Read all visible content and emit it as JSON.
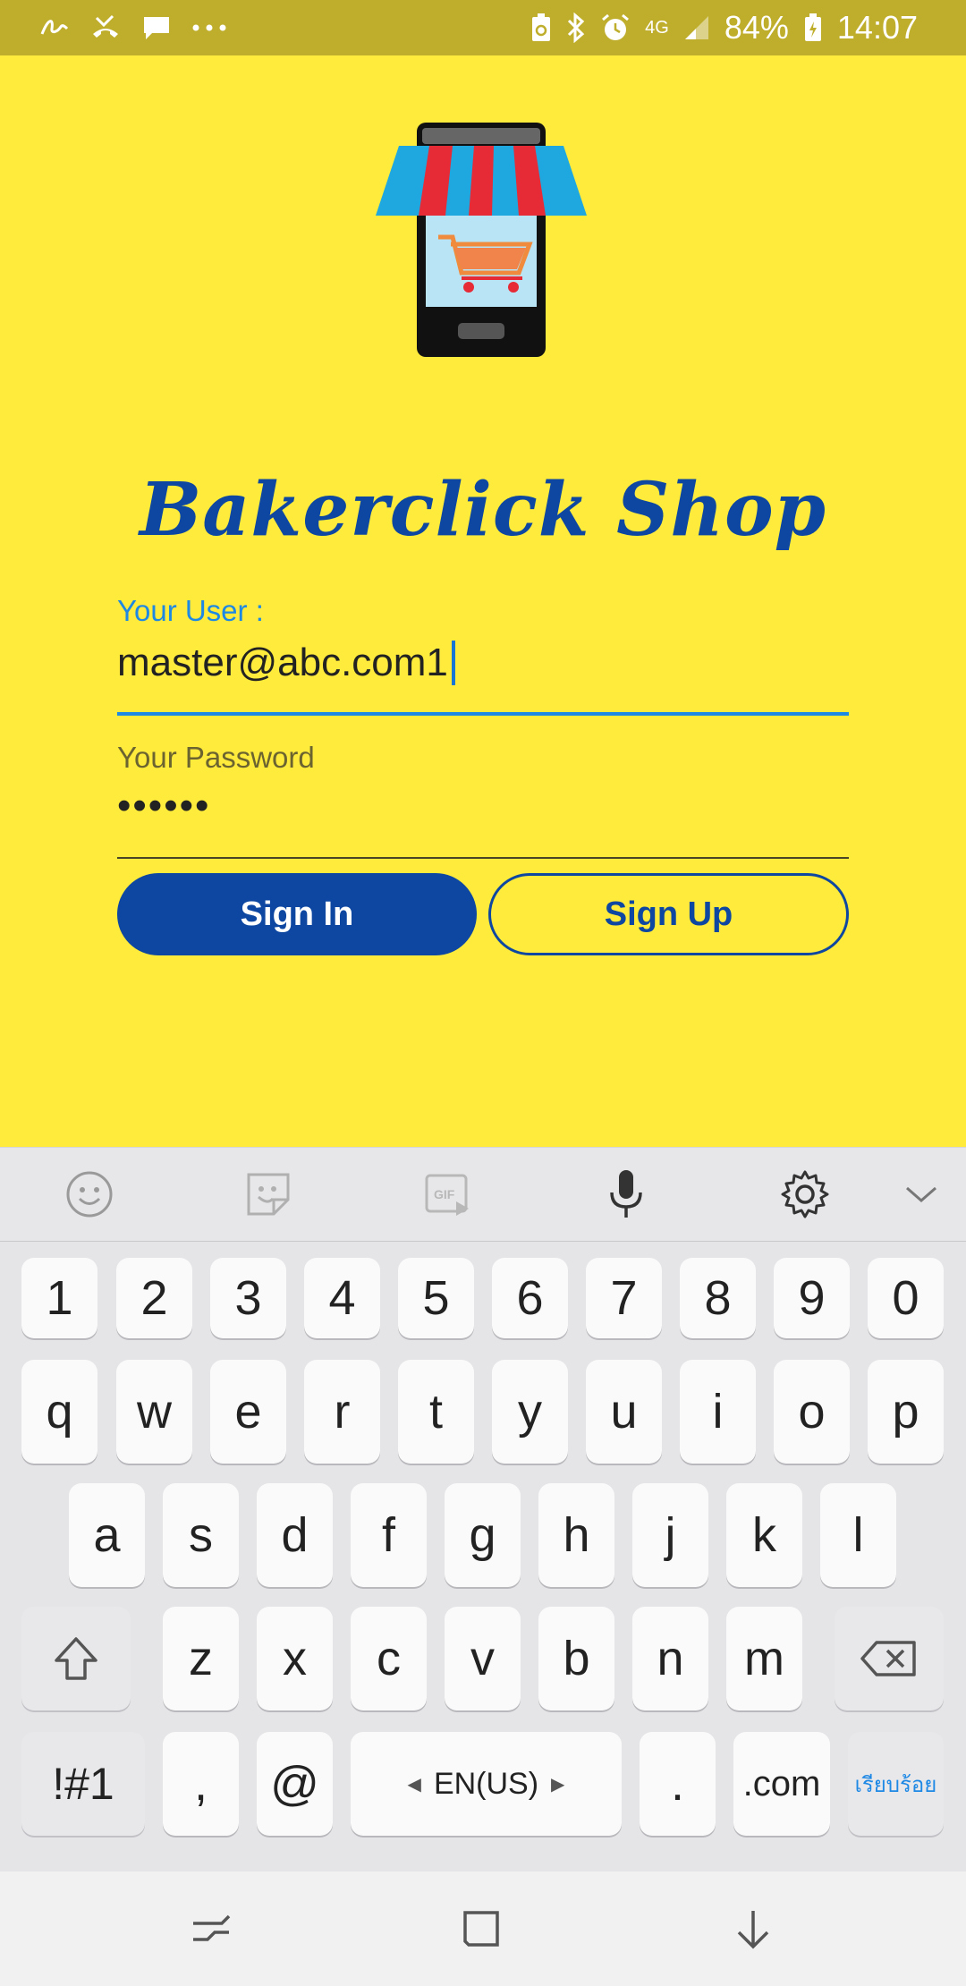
{
  "status_bar": {
    "battery": "84%",
    "time": "14:07",
    "network": "4G",
    "left_icons": [
      "signature-icon",
      "missed-call-icon",
      "message-icon",
      "more-icon"
    ],
    "right_icons": [
      "recycle-battery-icon",
      "bluetooth-icon",
      "alarm-icon",
      "network-4g-icon",
      "signal-icon",
      "battery-charging-icon"
    ]
  },
  "app": {
    "brand": "Bakerclick Shop",
    "user_label": "Your User :",
    "user_value": "master@abc.com1",
    "password_label": "Your Password",
    "password_value": "••••••",
    "sign_in": "Sign In",
    "sign_up": "Sign Up",
    "colors": {
      "background": "#ffeb3b",
      "primary": "#0d47a1",
      "accent": "#1e88e5"
    }
  },
  "keyboard": {
    "toolbar": [
      "emoji-icon",
      "sticker-icon",
      "gif-icon",
      "microphone-icon",
      "settings-icon",
      "collapse-icon"
    ],
    "row_numbers": [
      "1",
      "2",
      "3",
      "4",
      "5",
      "6",
      "7",
      "8",
      "9",
      "0"
    ],
    "row_q": [
      "q",
      "w",
      "e",
      "r",
      "t",
      "y",
      "u",
      "i",
      "o",
      "p"
    ],
    "row_a": [
      "a",
      "s",
      "d",
      "f",
      "g",
      "h",
      "j",
      "k",
      "l"
    ],
    "row_z": [
      "z",
      "x",
      "c",
      "v",
      "b",
      "n",
      "m"
    ],
    "symbols": "!#1",
    "comma": ",",
    "at": "@",
    "language": "EN(US)",
    "period": ".",
    "dotcom": ".com",
    "done": "เรียบร้อย"
  },
  "navbar": [
    "recent-apps-icon",
    "home-icon",
    "back-icon"
  ]
}
